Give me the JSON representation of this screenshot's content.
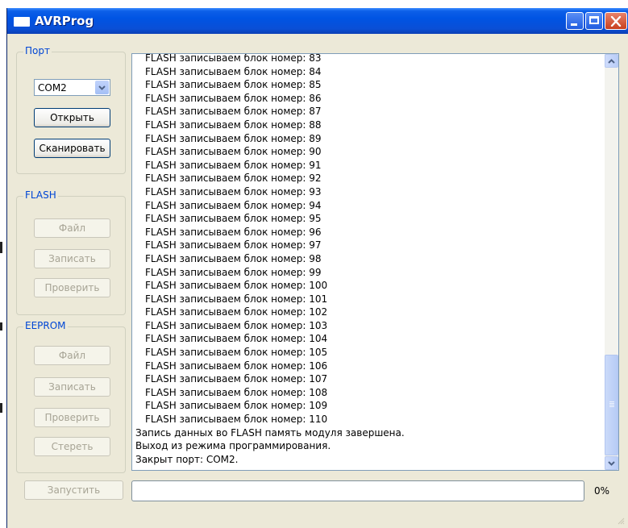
{
  "window": {
    "title": "AVRProg"
  },
  "port": {
    "group_label": "Порт",
    "selected": "COM2",
    "open_label": "Открыть",
    "scan_label": "Сканировать"
  },
  "flash": {
    "group_label": "FLASH",
    "file_label": "Файл",
    "write_label": "Записать",
    "verify_label": "Проверить"
  },
  "eeprom": {
    "group_label": "EEPROM",
    "file_label": "Файл",
    "write_label": "Записать",
    "verify_label": "Проверить",
    "erase_label": "Стереть"
  },
  "run_label": "Запустить",
  "log": {
    "lines": [
      {
        "text": "FLASH записываем блок номер: 83",
        "indent": true
      },
      {
        "text": "FLASH записываем блок номер: 84",
        "indent": true
      },
      {
        "text": "FLASH записываем блок номер: 85",
        "indent": true
      },
      {
        "text": "FLASH записываем блок номер: 86",
        "indent": true
      },
      {
        "text": "FLASH записываем блок номер: 87",
        "indent": true
      },
      {
        "text": "FLASH записываем блок номер: 88",
        "indent": true
      },
      {
        "text": "FLASH записываем блок номер: 89",
        "indent": true
      },
      {
        "text": "FLASH записываем блок номер: 90",
        "indent": true
      },
      {
        "text": "FLASH записываем блок номер: 91",
        "indent": true
      },
      {
        "text": "FLASH записываем блок номер: 92",
        "indent": true
      },
      {
        "text": "FLASH записываем блок номер: 93",
        "indent": true
      },
      {
        "text": "FLASH записываем блок номер: 94",
        "indent": true
      },
      {
        "text": "FLASH записываем блок номер: 95",
        "indent": true
      },
      {
        "text": "FLASH записываем блок номер: 96",
        "indent": true
      },
      {
        "text": "FLASH записываем блок номер: 97",
        "indent": true
      },
      {
        "text": "FLASH записываем блок номер: 98",
        "indent": true
      },
      {
        "text": "FLASH записываем блок номер: 99",
        "indent": true
      },
      {
        "text": "FLASH записываем блок номер: 100",
        "indent": true
      },
      {
        "text": "FLASH записываем блок номер: 101",
        "indent": true
      },
      {
        "text": "FLASH записываем блок номер: 102",
        "indent": true
      },
      {
        "text": "FLASH записываем блок номер: 103",
        "indent": true
      },
      {
        "text": "FLASH записываем блок номер: 104",
        "indent": true
      },
      {
        "text": "FLASH записываем блок номер: 105",
        "indent": true
      },
      {
        "text": "FLASH записываем блок номер: 106",
        "indent": true
      },
      {
        "text": "FLASH записываем блок номер: 107",
        "indent": true
      },
      {
        "text": "FLASH записываем блок номер: 108",
        "indent": true
      },
      {
        "text": "FLASH записываем блок номер: 109",
        "indent": true
      },
      {
        "text": "FLASH записываем блок номер: 110",
        "indent": true
      },
      {
        "text": "Запись данных во FLASH память модуля завершена.",
        "indent": false
      },
      {
        "text": "Выход из режима программирования.",
        "indent": false
      },
      {
        "text": "Закрыт порт: COM2.",
        "indent": false
      }
    ]
  },
  "progress": {
    "value": 0,
    "percent_label": "0%"
  },
  "colors": {
    "titlebar": "#0054e3",
    "group_title": "#0046d5",
    "window_bg": "#ece9d8"
  }
}
